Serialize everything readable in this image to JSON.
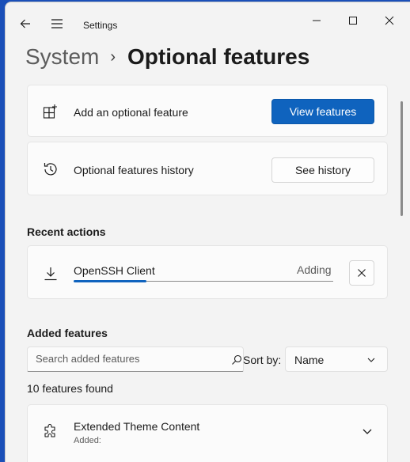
{
  "window": {
    "app_title": "Settings"
  },
  "breadcrumb": {
    "parent": "System",
    "separator": "›",
    "current": "Optional features"
  },
  "add_feature": {
    "label": "Add an optional feature",
    "button": "View features",
    "icon": "add-apps-icon"
  },
  "history": {
    "label": "Optional features history",
    "button": "See history",
    "icon": "history-icon"
  },
  "recent_actions": {
    "title": "Recent actions",
    "item": {
      "name": "OpenSSH Client",
      "status": "Adding",
      "progress": 0.28,
      "icon": "download-icon"
    }
  },
  "added_features": {
    "title": "Added features",
    "search_placeholder": "Search added features",
    "search_value": "",
    "sort_label": "Sort by:",
    "sort_value": "Name",
    "count": "10 features found",
    "items": [
      {
        "name": "Extended Theme Content",
        "sub": "Added:",
        "icon": "puzzle-icon"
      }
    ]
  },
  "colors": {
    "accent": "#0f63be",
    "window_bg": "#f3f3f3",
    "card_bg": "#fbfbfb"
  }
}
